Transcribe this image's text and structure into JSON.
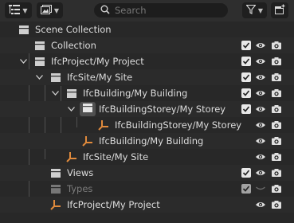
{
  "toolbar": {
    "display_mode_icon": "outliner-display-icon",
    "filter_type_icon": "view-filter-icon",
    "search_placeholder": "Search",
    "filter_icon": "funnel-icon",
    "new_collection_icon": "new-collection-icon"
  },
  "tree": [
    {
      "label": "Scene Collection",
      "type": "scene"
    },
    {
      "label": "Collection",
      "type": "collection"
    },
    {
      "label": "IfcProject/My Project",
      "type": "collection"
    },
    {
      "label": "IfcSite/My Site",
      "type": "collection"
    },
    {
      "label": "IfcBuilding/My Building",
      "type": "collection"
    },
    {
      "label": "IfcBuildingStorey/My Storey",
      "type": "collection"
    },
    {
      "label": "IfcBuildingStorey/My Storey",
      "type": "empty"
    },
    {
      "label": "IfcBuilding/My Building",
      "type": "empty"
    },
    {
      "label": "IfcSite/My Site",
      "type": "empty"
    },
    {
      "label": "Views",
      "type": "collection"
    },
    {
      "label": "Types",
      "type": "collection",
      "excluded": true
    },
    {
      "label": "IfcProject/My Project",
      "type": "empty"
    }
  ],
  "colors": {
    "background": "#282828",
    "header": "#2e2e2e",
    "text": "#dddddd",
    "text_dim": "#7c7c7c",
    "empty_axes": "#e08a3c",
    "checkbox": "#e8e8e8"
  }
}
